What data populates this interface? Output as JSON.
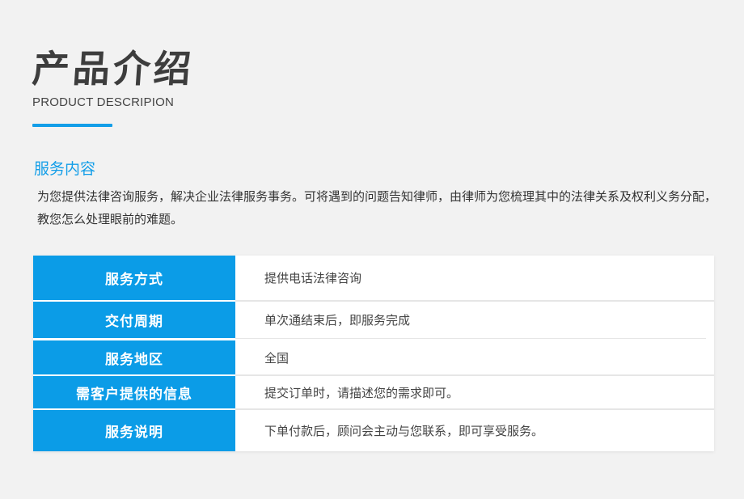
{
  "header": {
    "title": "产品介绍",
    "subtitle": "PRODUCT DESCRIPION"
  },
  "section": {
    "heading": "服务内容",
    "description": "为您提供法律咨询服务，解决企业法律服务事务。可将遇到的问题告知律师，由律师为您梳理其中的法律关系及权利义务分配，教您怎么处理眼前的难题。"
  },
  "table": {
    "rows": [
      {
        "label": "服务方式",
        "value": "提供电话法律咨询"
      },
      {
        "label": "交付周期",
        "value": "单次通结束后，即服务完成"
      },
      {
        "label": "服务地区",
        "value": "全国"
      },
      {
        "label": "需客户提供的信息",
        "value": "提交订单时，请描述您的需求即可。"
      },
      {
        "label": "服务说明",
        "value": "下单付款后，顾问会主动与您联系，即可享受服务。"
      }
    ]
  },
  "colors": {
    "accent": "#139ee8",
    "label_background": "#0b9ce7",
    "page_background": "#f2f2f2"
  }
}
